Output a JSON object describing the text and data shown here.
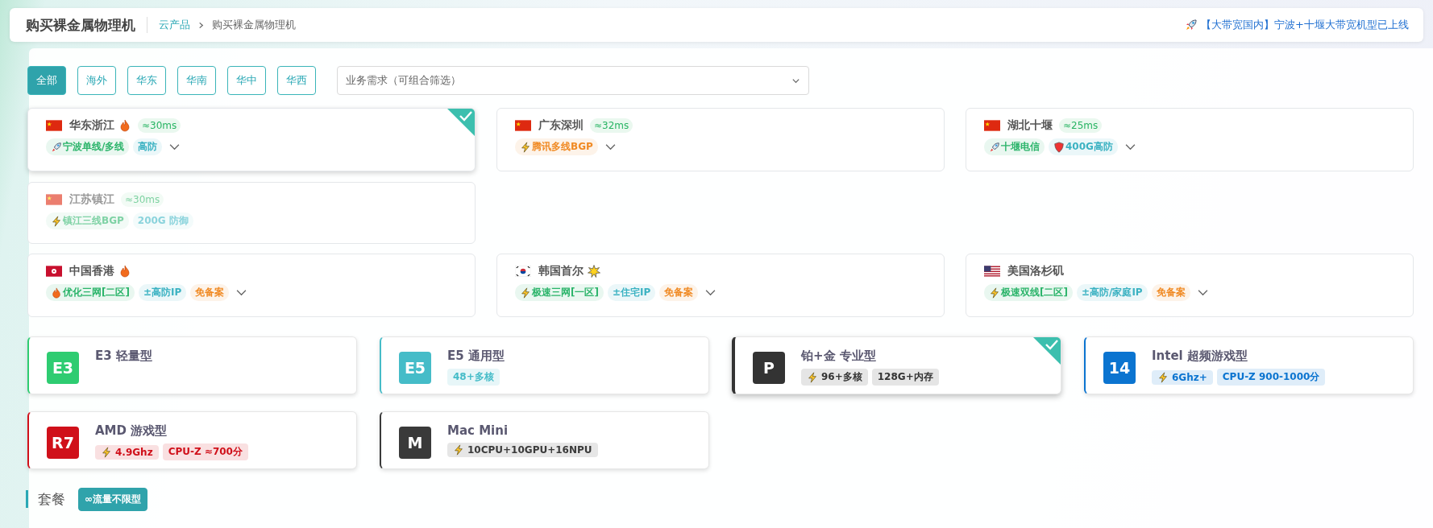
{
  "header": {
    "title": "购买裸金属物理机",
    "breadcrumb": [
      {
        "label": "云产品",
        "link": true
      },
      {
        "label": "购买裸金属物理机",
        "link": false
      }
    ],
    "notice": "【大带宽国内】宁波+十堰大带宽机型已上线"
  },
  "filters": [
    {
      "label": "全部",
      "selected": true
    },
    {
      "label": "海外",
      "selected": false
    },
    {
      "label": "华东",
      "selected": false
    },
    {
      "label": "华南",
      "selected": false
    },
    {
      "label": "华中",
      "selected": false
    },
    {
      "label": "华西",
      "selected": false
    }
  ],
  "demand_select": {
    "placeholder": "业务需求（可组合筛选）"
  },
  "region_groups": [
    {
      "regions": [
        {
          "kind": "cn",
          "name": "华东浙江",
          "hot": true,
          "new": false,
          "latency": "≈30ms",
          "selected": true,
          "disabled": false,
          "more": true,
          "tags": [
            {
              "kind": "rocket",
              "color": "#2bb46a",
              "label": "宁波单线/多线"
            },
            {
              "kind": "plain",
              "color": "#3bb2c2",
              "label": "高防"
            }
          ]
        },
        {
          "kind": "cn",
          "name": "广东深圳",
          "hot": false,
          "new": false,
          "latency": "≈32ms",
          "selected": false,
          "disabled": false,
          "more": true,
          "tags": [
            {
              "kind": "bolt",
              "color": "#f08a24",
              "label": "腾讯多线BGP"
            }
          ]
        },
        {
          "kind": "cn",
          "name": "湖北十堰",
          "hot": false,
          "new": false,
          "latency": "≈25ms",
          "selected": false,
          "disabled": false,
          "more": true,
          "tags": [
            {
              "kind": "rocket",
              "color": "#2bb46a",
              "label": "十堰电信"
            },
            {
              "kind": "shield",
              "color": "#3bb2c2",
              "label": "400G高防"
            }
          ]
        },
        {
          "kind": "cn",
          "name": "江苏镇江",
          "hot": false,
          "new": false,
          "latency": "≈30ms",
          "selected": false,
          "disabled": true,
          "more": false,
          "tags": [
            {
              "kind": "bolt",
              "color": "#7fd2a5",
              "label": "镇江三线BGP"
            },
            {
              "kind": "plain",
              "color": "#8ad3dc",
              "label": "200G 防御"
            }
          ]
        }
      ]
    },
    {
      "regions": [
        {
          "kind": "hk",
          "name": "中国香港",
          "hot": true,
          "new": false,
          "selected": false,
          "disabled": false,
          "more": true,
          "tags": [
            {
              "kind": "fire",
              "color": "#2bb46a",
              "label": "优化三网[二区]"
            },
            {
              "kind": "plain",
              "color": "#3bb2c2",
              "label": "±高防IP"
            },
            {
              "kind": "plain",
              "color": "#f08a24",
              "label": "免备案"
            }
          ]
        },
        {
          "kind": "kr",
          "name": "韩国首尔",
          "hot": false,
          "new": true,
          "selected": false,
          "disabled": false,
          "more": true,
          "tags": [
            {
              "kind": "bolt",
              "color": "#2bb46a",
              "label": "极速三网[一区]"
            },
            {
              "kind": "plain",
              "color": "#3bb2c2",
              "label": "±住宅IP"
            },
            {
              "kind": "plain",
              "color": "#f08a24",
              "label": "免备案"
            }
          ]
        },
        {
          "kind": "us",
          "name": "美国洛杉矶",
          "hot": false,
          "new": false,
          "selected": false,
          "disabled": false,
          "more": true,
          "tags": [
            {
              "kind": "bolt",
              "color": "#2bb46a",
              "label": "极速双线[二区]"
            },
            {
              "kind": "plain",
              "color": "#3bb2c2",
              "label": "±高防/家庭IP"
            },
            {
              "kind": "plain",
              "color": "#f08a24",
              "label": "免备案"
            }
          ]
        }
      ]
    }
  ],
  "models": [
    {
      "badge": "E3",
      "color": "#2ecc71",
      "name": "E3 轻量型",
      "selected": false
    },
    {
      "badge": "E5",
      "color": "#45bcc8",
      "name": "E5 通用型",
      "selected": false,
      "tags": [
        {
          "bolt": false,
          "label": "48+多核"
        }
      ]
    },
    {
      "badge": "P",
      "color": "#333333",
      "name": "铂+金 专业型",
      "selected": true,
      "tags": [
        {
          "bolt": true,
          "label": "96+多核"
        },
        {
          "bolt": false,
          "label": "128G+内存"
        }
      ]
    },
    {
      "badge": "14",
      "color": "#0b74d0",
      "name": "Intel 超频游戏型",
      "selected": false,
      "tags": [
        {
          "bolt": true,
          "label": "6Ghz+"
        },
        {
          "bolt": false,
          "label": "CPU-Z 900-1000分"
        }
      ]
    },
    {
      "badge": "R7",
      "color": "#d0101a",
      "name": "AMD 游戏型",
      "selected": false,
      "tags": [
        {
          "bolt": true,
          "label": "4.9Ghz"
        },
        {
          "bolt": false,
          "label": "CPU-Z ≈700分"
        }
      ]
    },
    {
      "badge": "M",
      "color": "#3a3a3a",
      "name": "Mac Mini",
      "selected": false,
      "tags": [
        {
          "bolt": true,
          "label": "10CPU+10GPU+16NPU"
        }
      ]
    }
  ],
  "package_section": {
    "title": "套餐",
    "options": [
      {
        "label": "∞流量不限型",
        "selected": true
      }
    ]
  }
}
